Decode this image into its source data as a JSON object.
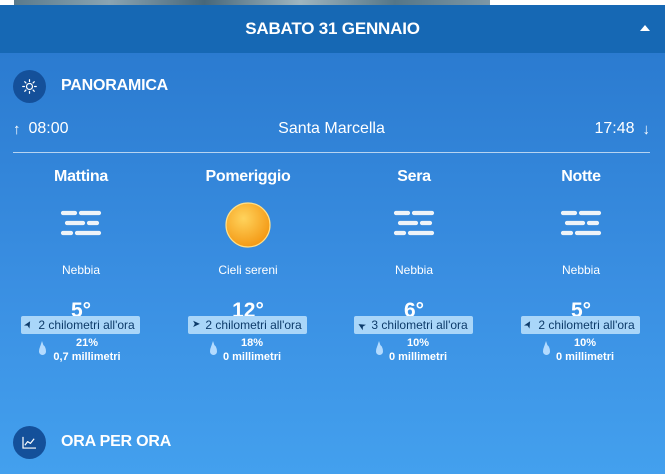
{
  "day_header": {
    "title": "SABATO 31 GENNAIO"
  },
  "overview": {
    "title": "PANORAMICA",
    "sunrise": "08:00",
    "location": "Santa Marcella",
    "sunset": "17:48"
  },
  "periods": [
    {
      "name": "Mattina",
      "icon": "fog-icon",
      "condition": "Nebbia",
      "temp": "5°",
      "rain_prob": "21%",
      "rain_mm": "0,7 millimetri",
      "wind": "2 chilometri all'ora",
      "wind_dir_deg": 30
    },
    {
      "name": "Pomeriggio",
      "icon": "sun-icon",
      "condition": "Cieli sereni",
      "temp": "12°",
      "rain_prob": "18%",
      "rain_mm": "0 millimetri",
      "wind": "2 chilometri all'ora",
      "wind_dir_deg": 90
    },
    {
      "name": "Sera",
      "icon": "fog-icon",
      "condition": "Nebbia",
      "temp": "6°",
      "rain_prob": "10%",
      "rain_mm": "0 millimetri",
      "wind": "3 chilometri all'ora",
      "wind_dir_deg": 300
    },
    {
      "name": "Notte",
      "icon": "fog-icon",
      "condition": "Nebbia",
      "temp": "5°",
      "rain_prob": "10%",
      "rain_mm": "0 millimetri",
      "wind": "2 chilometri all'ora",
      "wind_dir_deg": 30
    }
  ],
  "hourly": {
    "title": "ORA PER ORA"
  },
  "colors": {
    "header_bg": "#1668b4",
    "icon_circle": "#14509a",
    "wind_badge_bg": "#a9d6f9",
    "wind_badge_text": "#0d3b6a",
    "sun": "#fbb034"
  }
}
